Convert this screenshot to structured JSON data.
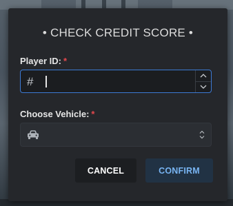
{
  "dialog": {
    "title": "• CHECK CREDIT SCORE •"
  },
  "player_id": {
    "label": "Player ID:",
    "required_mark": "*",
    "value": "",
    "prefix_icon": "hash-icon",
    "stepper_up_icon": "chevron-up-icon",
    "stepper_down_icon": "chevron-down-icon"
  },
  "vehicle": {
    "label": "Choose Vehicle:",
    "required_mark": "*",
    "selected_value": "",
    "prefix_icon": "car-icon",
    "dropdown_icon": "select-chevrons-icon"
  },
  "actions": {
    "cancel_label": "CANCEL",
    "confirm_label": "CONFIRM"
  },
  "colors": {
    "dialog_background": "#25272b",
    "focus_border": "#3d7bd6",
    "required": "#e5484d",
    "confirm_text": "#78b4f2",
    "confirm_background": "#213244",
    "cancel_background": "#1c1e21"
  }
}
